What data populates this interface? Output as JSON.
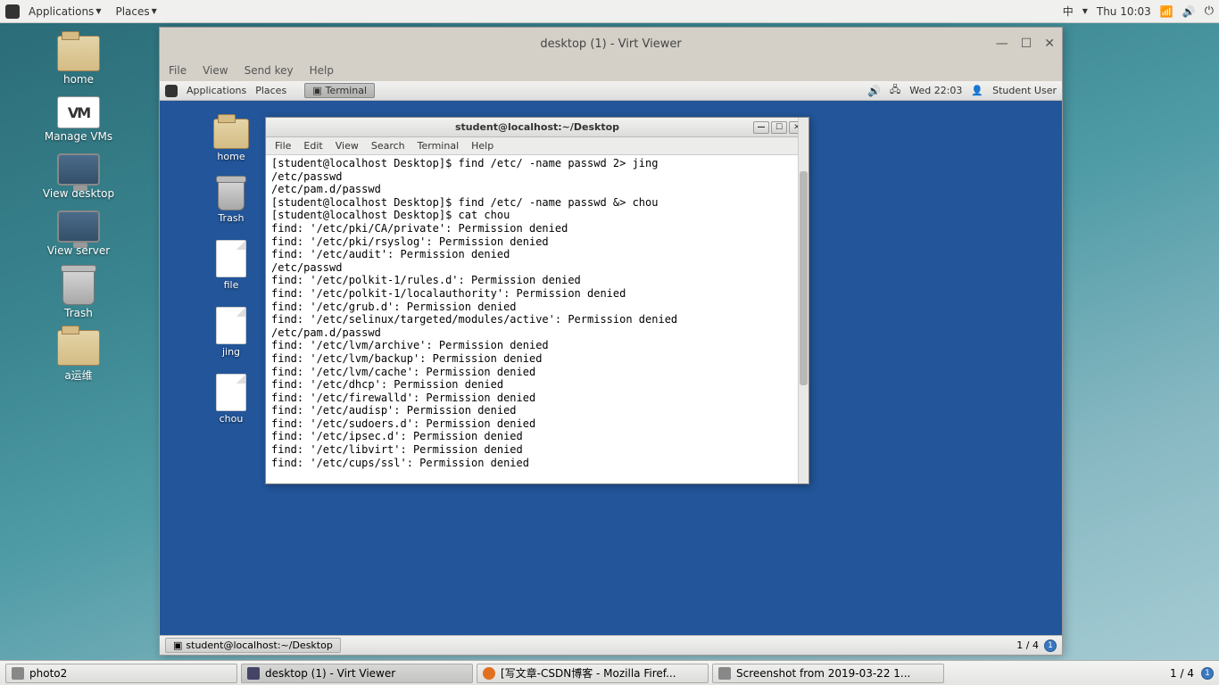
{
  "outer_top": {
    "applications": "Applications",
    "places": "Places",
    "ime": "中",
    "clock": "Thu 10:03"
  },
  "outer_icons": {
    "home": "home",
    "manage_vms": "Manage VMs",
    "view_desktop": "View desktop",
    "view_server": "View server",
    "trash": "Trash",
    "ops": "a运维"
  },
  "vv": {
    "title": "desktop (1) - Virt Viewer",
    "menu": {
      "file": "File",
      "view": "View",
      "sendkey": "Send key",
      "help": "Help"
    }
  },
  "inner_top": {
    "applications": "Applications",
    "places": "Places",
    "terminal_task": "Terminal",
    "clock": "Wed 22:03",
    "user": "Student User"
  },
  "inner_icons": {
    "home": "home",
    "trash": "Trash",
    "file": "file",
    "jing": "jing",
    "chou": "chou"
  },
  "term": {
    "title": "student@localhost:~/Desktop",
    "menu": {
      "file": "File",
      "edit": "Edit",
      "view": "View",
      "search": "Search",
      "terminal": "Terminal",
      "help": "Help"
    },
    "content": "[student@localhost Desktop]$ find /etc/ -name passwd 2> jing\n/etc/passwd\n/etc/pam.d/passwd\n[student@localhost Desktop]$ find /etc/ -name passwd &> chou\n[student@localhost Desktop]$ cat chou\nfind: '/etc/pki/CA/private': Permission denied\nfind: '/etc/pki/rsyslog': Permission denied\nfind: '/etc/audit': Permission denied\n/etc/passwd\nfind: '/etc/polkit-1/rules.d': Permission denied\nfind: '/etc/polkit-1/localauthority': Permission denied\nfind: '/etc/grub.d': Permission denied\nfind: '/etc/selinux/targeted/modules/active': Permission denied\n/etc/pam.d/passwd\nfind: '/etc/lvm/archive': Permission denied\nfind: '/etc/lvm/backup': Permission denied\nfind: '/etc/lvm/cache': Permission denied\nfind: '/etc/dhcp': Permission denied\nfind: '/etc/firewalld': Permission denied\nfind: '/etc/audisp': Permission denied\nfind: '/etc/sudoers.d': Permission denied\nfind: '/etc/ipsec.d': Permission denied\nfind: '/etc/libvirt': Permission denied\nfind: '/etc/cups/ssl': Permission denied"
  },
  "inner_bottom": {
    "task": "student@localhost:~/Desktop",
    "ws": "1 / 4"
  },
  "outer_bottom": {
    "photo2": "photo2",
    "vv": "desktop (1) - Virt Viewer",
    "firefox": "[写文章-CSDN博客 - Mozilla Firef...",
    "screenshot": "Screenshot from 2019-03-22 1...",
    "ws": "1 / 4"
  }
}
